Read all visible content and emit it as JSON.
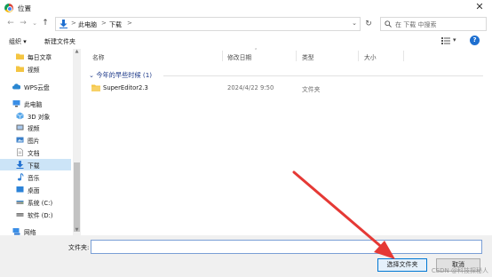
{
  "window": {
    "title": "位置",
    "close_glyph": "✕",
    "app_icon": "chrome-icon"
  },
  "address_bar": {
    "back_glyph": "←",
    "forward_glyph": "→",
    "dropdown_glyph": "⌄",
    "up_glyph": "↑",
    "breadcrumb": [
      "此电脑",
      "下载"
    ],
    "separator": ">",
    "path_dropdown_glyph": "⌄",
    "refresh_glyph": "↻",
    "search_placeholder": "在 下载 中搜索"
  },
  "toolbar": {
    "organize": "组织 ▾",
    "new_folder": "新建文件夹",
    "view_dropdown_glyph": "▾",
    "help_glyph": "?"
  },
  "sidebar": {
    "items": [
      {
        "label": "每日文章",
        "icon": "folder-icon"
      },
      {
        "label": "视频",
        "icon": "folder-icon"
      },
      {
        "label": "WPS云盘",
        "icon": "cloud-icon"
      },
      {
        "label": "此电脑",
        "icon": "computer-icon"
      },
      {
        "label": "3D 对象",
        "icon": "cube-icon"
      },
      {
        "label": "视频",
        "icon": "video-icon"
      },
      {
        "label": "图片",
        "icon": "picture-icon"
      },
      {
        "label": "文档",
        "icon": "document-icon"
      },
      {
        "label": "下载",
        "icon": "download-icon",
        "selected": true
      },
      {
        "label": "音乐",
        "icon": "music-icon"
      },
      {
        "label": "桌面",
        "icon": "desktop-icon"
      },
      {
        "label": "系统 (C:)",
        "icon": "drive-icon"
      },
      {
        "label": "软件 (D:)",
        "icon": "drive-icon"
      },
      {
        "label": "网络",
        "icon": "network-icon"
      }
    ]
  },
  "file_list": {
    "columns": [
      "名称",
      "修改日期",
      "类型",
      "大小"
    ],
    "group_label": "今年的早些时候 (1)",
    "group_toggle_glyph": "⌄",
    "rows": [
      {
        "name": "SuperEditor2.3",
        "modified": "2024/4/22 9:50",
        "type": "文件夹",
        "size": ""
      }
    ]
  },
  "footer": {
    "filename_label": "文件夹:",
    "filename_value": "",
    "select_button": "选择文件夹",
    "cancel_button": "取消"
  },
  "watermark": "CSDN @科技探秘人",
  "colors": {
    "accent": "#0078d4",
    "selection": "#cce4f7",
    "arrow": "#e53935",
    "folder": "#f4c542"
  }
}
